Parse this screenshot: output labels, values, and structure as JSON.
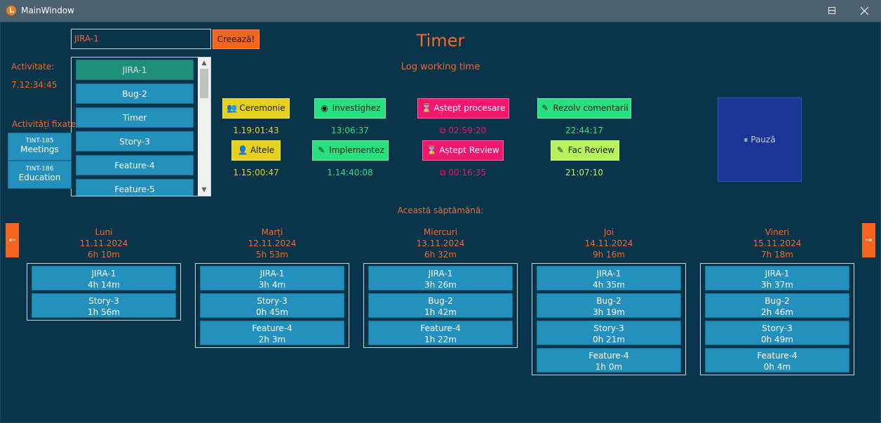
{
  "window": {
    "title": "MainWindow"
  },
  "top": {
    "task_input_value": "JIRA-1",
    "create_button": "Creează!",
    "app_title": "Timer",
    "subtitle": "Log working time"
  },
  "activity": {
    "label": "Activitate:",
    "value": "7.12:34:45"
  },
  "task_list": [
    "JIRA-1",
    "Bug-2",
    "Timer",
    "Story-3",
    "Feature-4",
    "Feature-5"
  ],
  "fixed": {
    "label": "Activități fixate",
    "items": [
      {
        "code": "TINT-185",
        "name": "Meetings"
      },
      {
        "code": "TINT-186",
        "name": "Education"
      }
    ]
  },
  "activities": [
    {
      "label": "Ceremonie",
      "icon": "people-icon",
      "time": "1.19:01:43"
    },
    {
      "label": "Altele",
      "icon": "person-icon",
      "time": "1.15:00:47"
    },
    {
      "label": "Investighez",
      "icon": "globe-icon",
      "time": "13:06:37"
    },
    {
      "label": "Implementez",
      "icon": "pencil-icon",
      "time": "1.14:40:08"
    },
    {
      "label": "Aștept procesare",
      "icon": "hourglass-icon",
      "time": "02:59:20"
    },
    {
      "label": "Aștept Review",
      "icon": "hourglass-icon",
      "time": "00:16:35"
    },
    {
      "label": "Rezolv comentarii",
      "icon": "pencil-icon",
      "time": "22:44:17"
    },
    {
      "label": "Fac Review",
      "icon": "pencil-icon",
      "time": "21:07:10"
    }
  ],
  "pause_button": "Pauză",
  "week": {
    "label": "Această săptămână:",
    "prev": "←",
    "next": "→",
    "days": [
      {
        "name": "Luni",
        "date": "11.11.2024",
        "total": "6h 10m",
        "entries": [
          {
            "task": "JIRA-1",
            "time": "4h 14m"
          },
          {
            "task": "Story-3",
            "time": "1h 56m"
          }
        ]
      },
      {
        "name": "Marți",
        "date": "12.11.2024",
        "total": "5h 53m",
        "entries": [
          {
            "task": "JIRA-1",
            "time": "3h 4m"
          },
          {
            "task": "Story-3",
            "time": "0h 45m"
          },
          {
            "task": "Feature-4",
            "time": "2h 3m"
          }
        ]
      },
      {
        "name": "Miercuri",
        "date": "13.11.2024",
        "total": "6h 32m",
        "entries": [
          {
            "task": "JIRA-1",
            "time": "3h 26m"
          },
          {
            "task": "Bug-2",
            "time": "1h 42m"
          },
          {
            "task": "Feature-4",
            "time": "1h 22m"
          }
        ]
      },
      {
        "name": "Joi",
        "date": "14.11.2024",
        "total": "9h 16m",
        "entries": [
          {
            "task": "JIRA-1",
            "time": "4h 35m"
          },
          {
            "task": "Bug-2",
            "time": "3h 19m"
          },
          {
            "task": "Story-3",
            "time": "0h 21m"
          },
          {
            "task": "Feature-4",
            "time": "1h 0m"
          }
        ]
      },
      {
        "name": "Vineri",
        "date": "15.11.2024",
        "total": "7h 18m",
        "entries": [
          {
            "task": "JIRA-1",
            "time": "3h 37m"
          },
          {
            "task": "Bug-2",
            "time": "2h 46m"
          },
          {
            "task": "Story-3",
            "time": "0h 49m"
          },
          {
            "task": "Feature-4",
            "time": "0h 4m"
          }
        ]
      }
    ]
  }
}
